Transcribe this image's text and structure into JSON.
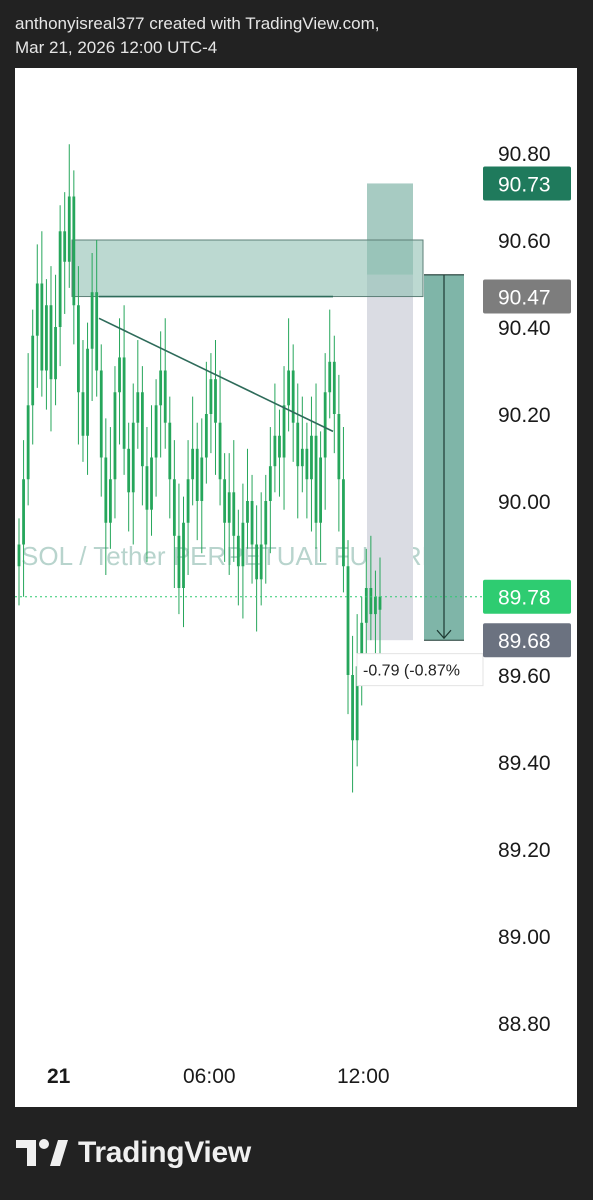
{
  "header": {
    "line1": "anthonyisreal377 created with TradingView.com,",
    "line2": "Mar 21, 2026 12:00 UTC-4"
  },
  "footer": {
    "brand": "TradingView",
    "logo_icon": "tradingview-logo-icon"
  },
  "colors": {
    "up": "#26a65b",
    "zone": "#8fbfb3",
    "projection": "#7fb5a8",
    "neutral_zone": "#dadce3",
    "current_price_label": "#2ecc71",
    "dark_label": "#1f7a5c",
    "grey_label": "#7d7d7d",
    "slate_label": "#6b7280",
    "watermark": "#b8d4cd"
  },
  "chart_data": {
    "type": "candlestick",
    "symbol_watermark": "SOL / Tether PERPETUAL FUTURES",
    "y_axis": {
      "range": [
        88.7,
        90.95
      ],
      "ticks": [
        "90.80",
        "90.60",
        "90.40",
        "90.20",
        "90.00",
        "89.60",
        "89.40",
        "89.20",
        "89.00",
        "88.80"
      ]
    },
    "x_axis": {
      "ticks": [
        "21",
        "06:00",
        "12:00"
      ]
    },
    "price_labels": [
      {
        "value": 90.73,
        "text": "90.73"
      },
      {
        "value": 90.47,
        "text": "90.47"
      },
      {
        "value": 89.78,
        "text": "89.78"
      },
      {
        "value": 89.68,
        "text": "89.68"
      }
    ],
    "current_price": 89.78,
    "measure_label": "-0.79 (-0.87%",
    "series_close": [
      89.9,
      90.05,
      90.22,
      90.38,
      90.5,
      90.3,
      90.45,
      90.28,
      90.4,
      90.62,
      90.55,
      90.7,
      90.45,
      90.25,
      90.15,
      90.35,
      90.48,
      90.3,
      90.1,
      89.95,
      90.05,
      90.25,
      90.33,
      90.12,
      90.02,
      90.18,
      90.25,
      90.08,
      89.98,
      90.1,
      90.22,
      90.3,
      90.18,
      90.05,
      89.92,
      89.8,
      89.95,
      90.05,
      90.12,
      90.0,
      90.1,
      90.2,
      90.28,
      90.18,
      90.05,
      89.95,
      90.02,
      89.92,
      89.85,
      89.95,
      90.0,
      89.9,
      89.82,
      89.9,
      90.0,
      90.08,
      90.15,
      90.1,
      90.22,
      90.3,
      90.18,
      90.08,
      90.12,
      90.05,
      90.15,
      89.95,
      90.1,
      90.25,
      90.32,
      90.2,
      90.05,
      89.85,
      89.6,
      89.45,
      89.62,
      89.72,
      89.8,
      89.74,
      89.78,
      89.75
    ],
    "annotations": [
      {
        "kind": "zone",
        "from": 90.47,
        "to": 90.6
      },
      {
        "kind": "horizontal_line",
        "value": 90.47
      },
      {
        "kind": "trendline",
        "from": 90.42,
        "to": 90.16
      },
      {
        "kind": "measure_projection",
        "top": 90.52,
        "bottom": 89.68
      },
      {
        "kind": "price_range_box",
        "top": 90.73,
        "bottom": 89.68
      }
    ]
  }
}
